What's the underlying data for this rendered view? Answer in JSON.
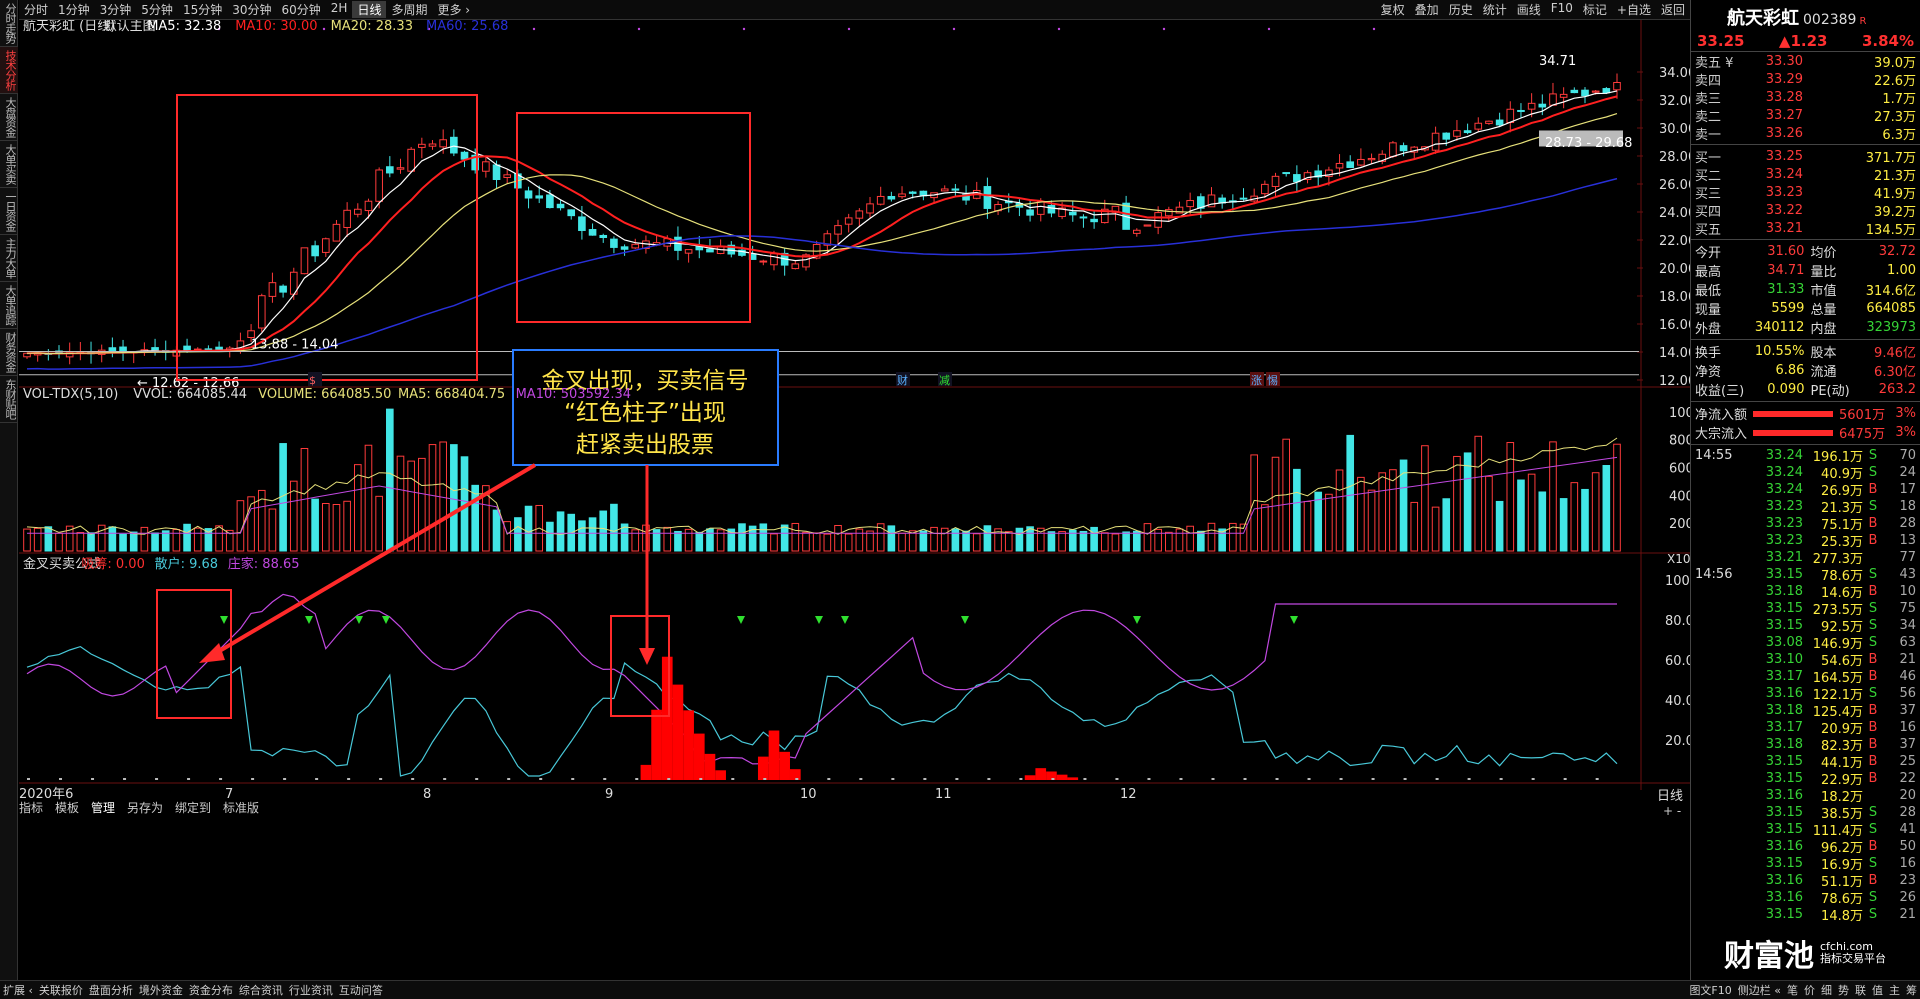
{
  "left_tabs": [
    "分时走势",
    "技术分析",
    "大盘资金",
    "大单买卖",
    "一日资金",
    "主力大单",
    "大单追踪",
    "财务资金",
    "东财贴吧"
  ],
  "period_tabs": [
    "分时",
    "1分钟",
    "3分钟",
    "5分钟",
    "15分钟",
    "30分钟",
    "60分钟",
    "2H",
    "日线",
    "多周期",
    "更多 ›"
  ],
  "right_tools": [
    "复权",
    "叠加",
    "历史",
    "统计",
    "画线",
    "F10",
    "标记",
    "+自选",
    "返回"
  ],
  "main_legend": {
    "stock": "航天彩虹 (日线)",
    "template": "默认主图",
    "ma5": "MA5: 32.38",
    "ma10": "MA10: 30.00",
    "ma20": "MA20: 28.33",
    "ma60": "MA60: 25.68"
  },
  "vol_legend": {
    "name": "VOL-TDX(5,10)",
    "vvol": "VVOL: 664085.44",
    "volume": "VOLUME: 664085.50",
    "ma5": "MA5: 668404.75",
    "ma10": "MA10: 503592.34"
  },
  "ind_legend": {
    "name": "金叉买卖公式",
    "xichou": "吸筹: 0.00",
    "sanhu": "散户: 9.68",
    "zhuangjia": "庄家: 88.65"
  },
  "annotation": {
    "line1": "金叉出现，买卖信号",
    "line2": "“红色柱子”出现",
    "line3": "赶紧卖出股票"
  },
  "price_labels": {
    "high": "34.71",
    "box_range": "28.73 - 29.68",
    "low_range1": "13.88 - 14.04",
    "low_range2": "← 12.62 - 12.66"
  },
  "event_marks": [
    "财",
    "减",
    "涨",
    "惕",
    "$"
  ],
  "colors": {
    "up": "#ff3b3b",
    "down": "#42e6e6",
    "ma5": "#ffffff",
    "ma10": "#ff2020",
    "ma20": "#e6e07a",
    "ma60": "#2830d8",
    "sanhu": "#48c8d8",
    "zhuangjia": "#c048e0",
    "xichou": "#ff0000"
  },
  "chart_data": [
    {
      "type": "candlestick",
      "title": "航天彩虹 (日线)",
      "y_axis": [
        12.0,
        14.0,
        16.0,
        18.0,
        20.0,
        22.0,
        24.0,
        26.0,
        28.0,
        30.0,
        32.0,
        34.0
      ],
      "ylim": [
        12.0,
        35.0
      ],
      "x_ticks": [
        "2020年6",
        "7",
        "8",
        "9",
        "10",
        "11",
        "12"
      ],
      "ohlc_segments": [
        {
          "from": "2020-06",
          "to": "2020-07",
          "start": 13.9,
          "end": 14.2
        },
        {
          "from": "2020-07",
          "to": "2020-08",
          "start": 14.2,
          "end": 29.5
        },
        {
          "from": "2020-08",
          "to": "2020-09",
          "start": 29.5,
          "end": 22.0
        },
        {
          "from": "2020-09",
          "to": "2020-10",
          "start": 22.0,
          "end": 20.5
        },
        {
          "from": "2020-10",
          "to": "2020-11",
          "start": 20.5,
          "end": 25.5
        },
        {
          "from": "2020-11",
          "to": "2020-12",
          "start": 25.5,
          "end": 23.0
        },
        {
          "from": "2020-12",
          "to": "end",
          "start": 23.0,
          "end": 33.25
        }
      ],
      "last_close": 33.25,
      "high": 34.71,
      "series": [
        {
          "name": "MA5",
          "last": 32.38
        },
        {
          "name": "MA10",
          "last": 30.0
        },
        {
          "name": "MA20",
          "last": 28.33
        },
        {
          "name": "MA60",
          "last": 25.68
        }
      ]
    },
    {
      "type": "bar",
      "title": "VOL-TDX(5,10)",
      "y_axis": [
        2000,
        4000,
        6000,
        8000,
        10000
      ],
      "ylim": [
        0,
        11000
      ],
      "unit": "X100",
      "last_volume": 664085.5
    },
    {
      "type": "line",
      "title": "金叉买卖公式",
      "y_axis": [
        20.0,
        40.0,
        60.0,
        80.0,
        100.0
      ],
      "ylim": [
        0,
        105
      ],
      "series": [
        {
          "name": "散户",
          "last": 9.68
        },
        {
          "name": "庄家",
          "last": 88.65
        },
        {
          "name": "吸筹",
          "last": 0.0,
          "peaks": [
            {
              "near": "2020-09",
              "value": 62
            },
            {
              "near": "2020-10",
              "value": 28
            },
            {
              "near": "2020-11",
              "value": 6
            }
          ]
        }
      ]
    }
  ],
  "quote": {
    "name": "航天彩虹",
    "code": "002389",
    "sup": "R",
    "price": "33.25",
    "change": "▲1.23",
    "pct": "3.84%",
    "sell": [
      {
        "l": "卖五 ¥",
        "p": "33.30",
        "v": "39.0万"
      },
      {
        "l": "卖四",
        "p": "33.29",
        "v": "22.6万"
      },
      {
        "l": "卖三",
        "p": "33.28",
        "v": "1.7万"
      },
      {
        "l": "卖二",
        "p": "33.27",
        "v": "27.3万"
      },
      {
        "l": "卖一",
        "p": "33.26",
        "v": "6.3万"
      }
    ],
    "buy": [
      {
        "l": "买一",
        "p": "33.25",
        "v": "371.7万"
      },
      {
        "l": "买二",
        "p": "33.24",
        "v": "21.3万"
      },
      {
        "l": "买三",
        "p": "33.23",
        "v": "41.9万"
      },
      {
        "l": "买四",
        "p": "33.22",
        "v": "39.2万"
      },
      {
        "l": "买五",
        "p": "33.21",
        "v": "134.5万"
      }
    ],
    "stats": [
      [
        "今开",
        "31.60",
        "均价",
        "32.72"
      ],
      [
        "最高",
        "34.71",
        "量比",
        "1.00"
      ],
      [
        "最低",
        "31.33",
        "市值",
        "314.6亿"
      ],
      [
        "现量",
        "5599",
        "总量",
        "664085"
      ],
      [
        "外盘",
        "340112",
        "内盘",
        "323973"
      ]
    ],
    "stats2": [
      [
        "换手",
        "10.55%",
        "股本",
        "9.46亿"
      ],
      [
        "净资",
        "6.86",
        "流通",
        "6.30亿"
      ],
      [
        "收益(三)",
        "0.090",
        "PE(动)",
        "263.2"
      ]
    ],
    "flows": [
      [
        "净流入额",
        "5601万",
        "3%"
      ],
      [
        "大宗流入",
        "6475万",
        "3%"
      ]
    ]
  },
  "ticks": [
    {
      "t": "14:55",
      "p": "33.24",
      "v": "196.1万",
      "s": "S",
      "n": "70"
    },
    {
      "t": "",
      "p": "33.24",
      "v": "40.9万",
      "s": "S",
      "n": "24"
    },
    {
      "t": "",
      "p": "33.24",
      "v": "26.9万",
      "s": "B",
      "n": "17"
    },
    {
      "t": "",
      "p": "33.23",
      "v": "21.3万",
      "s": "S",
      "n": "18"
    },
    {
      "t": "",
      "p": "33.23",
      "v": "75.1万",
      "s": "B",
      "n": "28"
    },
    {
      "t": "",
      "p": "33.23",
      "v": "25.3万",
      "s": "B",
      "n": "13"
    },
    {
      "t": "",
      "p": "33.21",
      "v": "277.3万",
      "s": "",
      "n": "77"
    },
    {
      "t": "14:56",
      "p": "33.15",
      "v": "78.6万",
      "s": "S",
      "n": "43"
    },
    {
      "t": "",
      "p": "33.18",
      "v": "14.6万",
      "s": "B",
      "n": "10"
    },
    {
      "t": "",
      "p": "33.15",
      "v": "273.5万",
      "s": "S",
      "n": "75"
    },
    {
      "t": "",
      "p": "33.15",
      "v": "92.5万",
      "s": "S",
      "n": "34"
    },
    {
      "t": "",
      "p": "33.08",
      "v": "146.9万",
      "s": "S",
      "n": "63"
    },
    {
      "t": "",
      "p": "33.10",
      "v": "54.6万",
      "s": "B",
      "n": "21"
    },
    {
      "t": "",
      "p": "33.17",
      "v": "164.5万",
      "s": "B",
      "n": "46"
    },
    {
      "t": "",
      "p": "33.16",
      "v": "122.1万",
      "s": "S",
      "n": "56"
    },
    {
      "t": "",
      "p": "33.18",
      "v": "125.4万",
      "s": "B",
      "n": "37"
    },
    {
      "t": "",
      "p": "33.17",
      "v": "20.9万",
      "s": "B",
      "n": "16"
    },
    {
      "t": "",
      "p": "33.18",
      "v": "82.3万",
      "s": "B",
      "n": "37"
    },
    {
      "t": "",
      "p": "33.15",
      "v": "44.1万",
      "s": "B",
      "n": "25"
    },
    {
      "t": "",
      "p": "33.15",
      "v": "22.9万",
      "s": "B",
      "n": "22"
    },
    {
      "t": "",
      "p": "33.16",
      "v": "18.2万",
      "s": "",
      "n": "20"
    },
    {
      "t": "",
      "p": "33.15",
      "v": "38.5万",
      "s": "S",
      "n": "28"
    },
    {
      "t": "",
      "p": "33.15",
      "v": "111.4万",
      "s": "S",
      "n": "41"
    },
    {
      "t": "",
      "p": "33.16",
      "v": "96.2万",
      "s": "B",
      "n": "50"
    },
    {
      "t": "",
      "p": "33.15",
      "v": "16.9万",
      "s": "S",
      "n": "16"
    },
    {
      "t": "",
      "p": "33.16",
      "v": "51.1万",
      "s": "B",
      "n": "23"
    },
    {
      "t": "",
      "p": "33.16",
      "v": "78.6万",
      "s": "S",
      "n": "26"
    },
    {
      "t": "",
      "p": "33.15",
      "v": "14.8万",
      "s": "S",
      "n": "21"
    }
  ],
  "bottom_left": [
    "扩展 ‹",
    "关联报价",
    "盘面分析",
    "境外资金",
    "资金分布",
    "综合资讯",
    "行业资讯",
    "互动问答"
  ],
  "bottom_tabs": [
    "指标",
    "模板",
    "管理",
    "另存为",
    "绑定到",
    "标准版"
  ],
  "bottom_right": [
    "图文F10",
    "侧边栏 «",
    "笔",
    "价",
    "细",
    "势",
    "联",
    "值",
    "主",
    "筹"
  ],
  "axis_extra": {
    "period": "日线",
    "minus_plus": "+ -"
  },
  "watermark": {
    "brand": "财富池",
    "site": "cfchi.com",
    "tag": "指标交易平台"
  }
}
